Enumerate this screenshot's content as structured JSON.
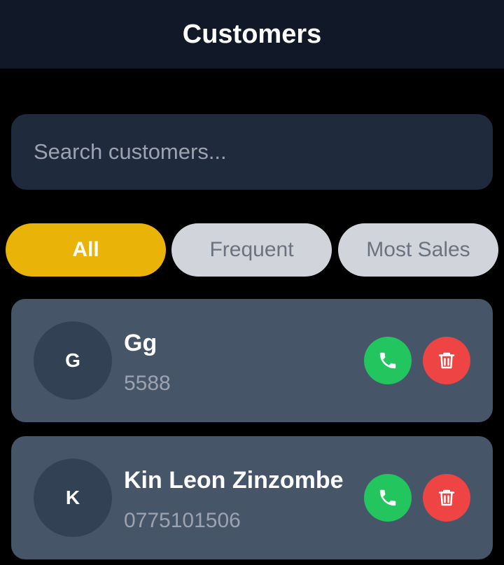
{
  "header": {
    "title": "Customers"
  },
  "search": {
    "placeholder": "Search customers..."
  },
  "filters": [
    {
      "label": "All",
      "active": true
    },
    {
      "label": "Frequent",
      "active": false
    },
    {
      "label": "Most Sales",
      "active": false
    }
  ],
  "customers": [
    {
      "initial": "G",
      "name": "Gg",
      "phone": "5588"
    },
    {
      "initial": "K",
      "name": "Kin Leon Zinzombe",
      "phone": "0775101506"
    }
  ],
  "icons": {
    "call": "phone-icon",
    "delete": "trash-icon"
  },
  "colors": {
    "accent": "#eab308",
    "call": "#22c55e",
    "delete": "#ef4444",
    "card": "#475569",
    "header": "#111827"
  }
}
